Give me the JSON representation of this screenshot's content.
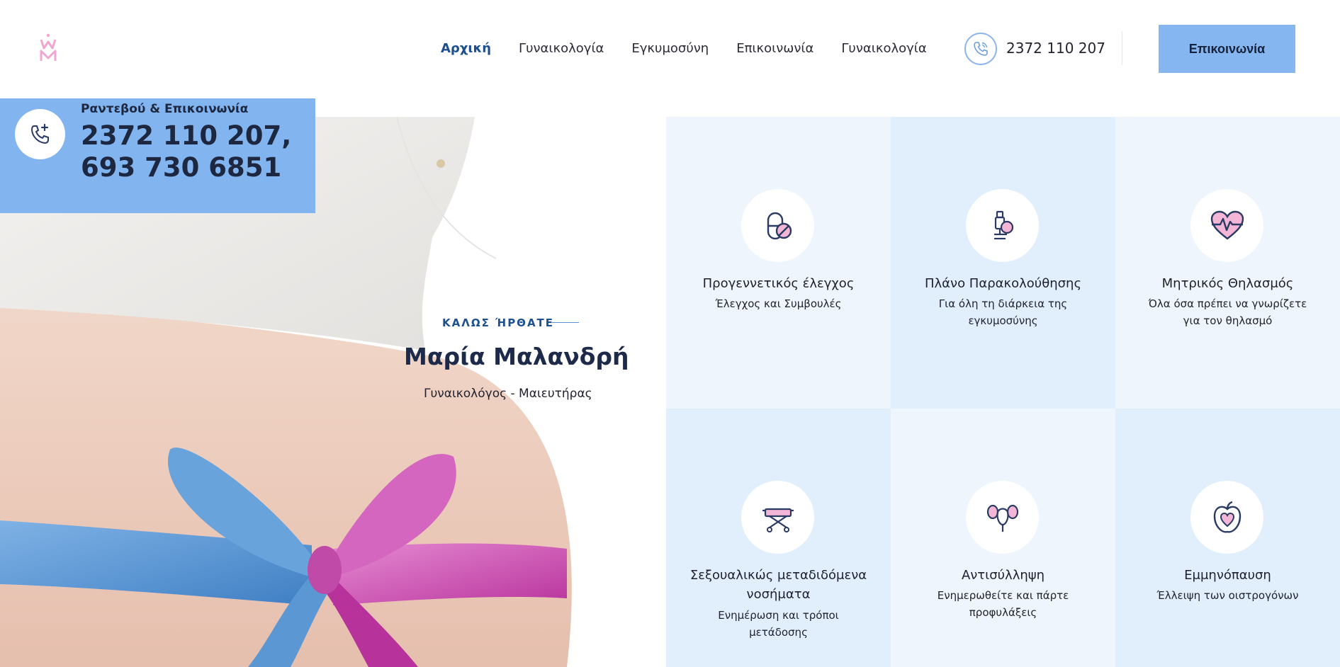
{
  "nav": {
    "items": [
      {
        "label": "Αρχική",
        "active": true
      },
      {
        "label": "Γυναικολογία",
        "active": false
      },
      {
        "label": "Εγκυμοσύνη",
        "active": false
      },
      {
        "label": "Επικοινωνία",
        "active": false
      },
      {
        "label": "Γυναικολογία",
        "active": false
      }
    ]
  },
  "header": {
    "phone": "2372 110 207",
    "cta_label": "Επικοινωνία"
  },
  "appointment": {
    "label": "Ραντεβού & Επικοινωνία",
    "phone_1": "2372 110 207,",
    "phone_2": "693 730 6851"
  },
  "hero": {
    "tagline": "ΚΑΛΩΣ ΉΡΘΑΤΕ",
    "name": "Μαρία Μαλανδρή",
    "profession": "Γυναικολόγος - Μαιευτήρας"
  },
  "services": [
    {
      "title": "Προγεννετικός έλεγχος",
      "subtitle": "Έλεγχος και Συμβουλές",
      "icon": "capsule-icon"
    },
    {
      "title": "Πλάνο Παρακολούθησης",
      "subtitle": "Για όλη τη διάρκεια της εγκυμοσύνης",
      "icon": "microscope-icon"
    },
    {
      "title": "Μητρικός Θηλασμός",
      "subtitle": "Όλα όσα πρέπει να γνωρίζετε για τον θηλασμό",
      "icon": "heartbeat-icon"
    },
    {
      "title": "Σεξουαλικώς μεταδιδόμενα νοσήματα",
      "subtitle": "Ενημέρωση και τρόποι μετάδοσης",
      "icon": "stretcher-icon"
    },
    {
      "title": "Αντισύλληψη",
      "subtitle": "Ενημερωθείτε και πάρτε προφυλάξεις",
      "icon": "uterus-icon"
    },
    {
      "title": "Εμμηνόπαυση",
      "subtitle": "Έλλειψη των οιστρογόνων",
      "icon": "apple-heart-icon"
    }
  ],
  "colors": {
    "accent_blue": "#82b4f0",
    "nav_active": "#1e4f8f",
    "grid_light": "#eef5fd",
    "grid_mid": "#e1effd",
    "icon_pink": "#f4b6d6",
    "icon_navy": "#2b3a63"
  }
}
